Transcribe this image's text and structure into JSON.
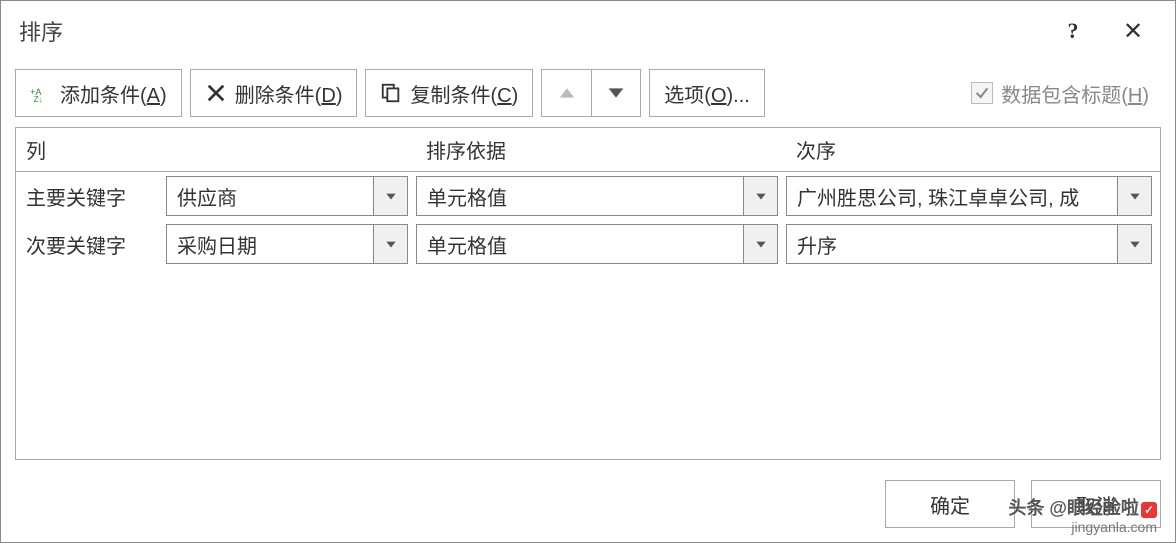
{
  "dialog": {
    "title": "排序",
    "help_label": "?",
    "close_label": "✕"
  },
  "toolbar": {
    "add_label_pre": "添加条件(",
    "add_label_key": "A",
    "add_label_post": ")",
    "del_label_pre": "删除条件(",
    "del_label_key": "D",
    "del_label_post": ")",
    "copy_label_pre": "复制条件(",
    "copy_label_key": "C",
    "copy_label_post": ")",
    "options_label_pre": "选项(",
    "options_label_key": "O",
    "options_label_post": ")...",
    "header_checkbox_pre": "数据包含标题(",
    "header_checkbox_key": "H",
    "header_checkbox_post": ")",
    "header_checkbox_checked": true
  },
  "grid": {
    "headers": {
      "col": "列",
      "sort_on": "排序依据",
      "order": "次序"
    },
    "rows": [
      {
        "label": "主要关键字",
        "col_value": "供应商",
        "sort_on_value": "单元格值",
        "order_value": "广州胜思公司, 珠江卓卓公司, 成"
      },
      {
        "label": "次要关键字",
        "col_value": "采购日期",
        "sort_on_value": "单元格值",
        "order_value": "升序"
      }
    ]
  },
  "footer": {
    "ok": "确定",
    "cancel": "取消"
  },
  "watermark": {
    "top_prefix": "头条  @",
    "top_name": "眼经验啦",
    "badge": "✓",
    "bottom": "jingyanla.com"
  }
}
